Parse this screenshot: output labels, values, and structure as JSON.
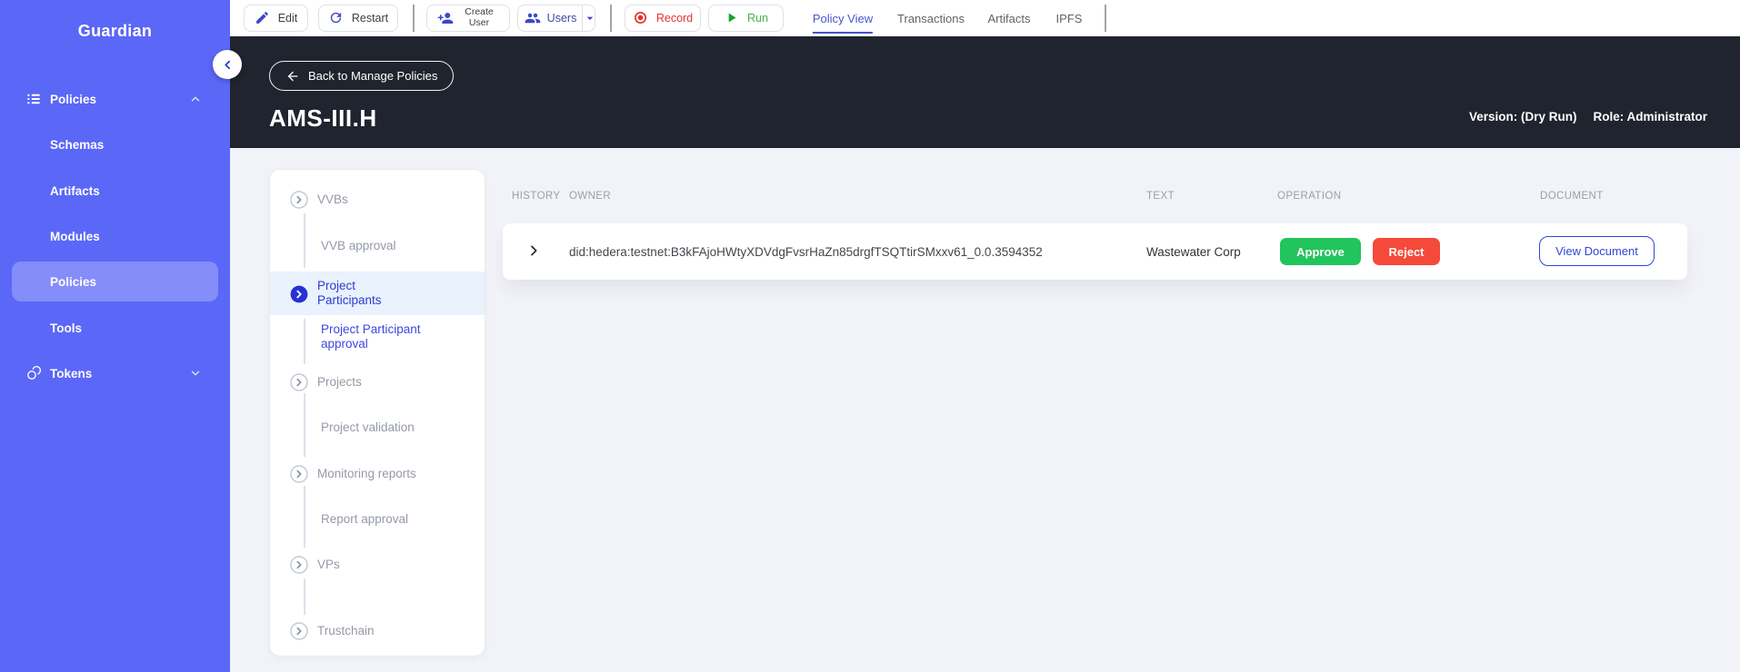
{
  "sidebar": {
    "logo": "Guardian",
    "policies_header": "Policies",
    "items": [
      {
        "label": "Schemas",
        "selected": false
      },
      {
        "label": "Artifacts",
        "selected": false
      },
      {
        "label": "Modules",
        "selected": false
      },
      {
        "label": "Policies",
        "selected": true
      },
      {
        "label": "Tools",
        "selected": false
      }
    ],
    "tokens_header": "Tokens"
  },
  "toolbar": {
    "edit": "Edit",
    "restart": "Restart",
    "create_user": "Create User",
    "users": "Users",
    "record": "Record",
    "run": "Run",
    "tabs": [
      {
        "label": "Policy View",
        "active": true
      },
      {
        "label": "Transactions",
        "active": false
      },
      {
        "label": "Artifacts",
        "active": false
      },
      {
        "label": "IPFS",
        "active": false
      }
    ]
  },
  "header": {
    "back_button": "Back to Manage Policies",
    "title": "AMS-III.H",
    "version": "Version: (Dry Run)",
    "role": "Role: Administrator"
  },
  "tree": {
    "items": [
      {
        "label": "VVBs",
        "type": "group",
        "selected": false
      },
      {
        "label": "VVB approval",
        "type": "leaf",
        "selected": false
      },
      {
        "label": "Project Participants",
        "type": "group",
        "selected": true
      },
      {
        "label": "Project Participant approval",
        "type": "leaf",
        "selected": true
      },
      {
        "label": "Projects",
        "type": "group",
        "selected": false
      },
      {
        "label": "Project validation",
        "type": "leaf",
        "selected": false
      },
      {
        "label": "Monitoring reports",
        "type": "group",
        "selected": false
      },
      {
        "label": "Report approval",
        "type": "leaf",
        "selected": false
      },
      {
        "label": "VPs",
        "type": "group",
        "selected": false
      },
      {
        "label": "Trustchain",
        "type": "group",
        "selected": false
      }
    ]
  },
  "table": {
    "columns": [
      "HISTORY",
      "OWNER",
      "TEXT",
      "OPERATION",
      "DOCUMENT"
    ],
    "rows": [
      {
        "owner": "did:hedera:testnet:B3kFAjoHWtyXDVdgFvsrHaZn85drgfTSQTtirSMxxv61_0.0.3594352",
        "text": "Wastewater Corp",
        "approve": "Approve",
        "reject": "Reject",
        "document": "View Document"
      }
    ]
  },
  "colors": {
    "sidebar": "#5b67f7",
    "header_dark": "#20242e",
    "accent_blue": "#3b49c4",
    "approve_green": "#22c45c",
    "reject_red": "#f5493a",
    "document_blue": "#2f46d9",
    "content_bg": "#f2f3f8"
  }
}
